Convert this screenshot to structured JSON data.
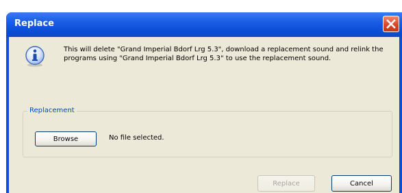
{
  "window": {
    "title": "Replace",
    "close_icon": "close-icon"
  },
  "dialog": {
    "icon": "info-icon",
    "message": "This will delete \"Grand Imperial Bdorf Lrg 5.3\", download a replacement sound and relink the programs using \"Grand Imperial Bdorf Lrg 5.3\" to use the replacement sound.",
    "group_label": "Replacement",
    "browse_label": "Browse",
    "file_status": "No file selected.",
    "replace_label": "Replace",
    "cancel_label": "Cancel"
  },
  "colors": {
    "titlebar": "#1d5fe6",
    "client_bg": "#ece9d8",
    "group_label": "#0046d5",
    "close_button": "#d9462a"
  }
}
